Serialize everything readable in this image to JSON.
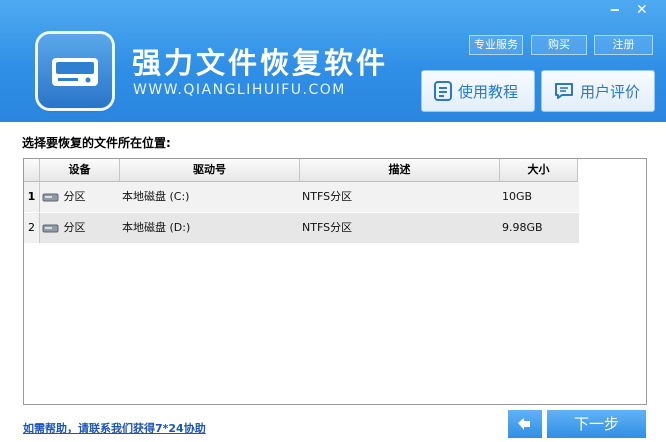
{
  "window": {
    "minimize": "‒",
    "close": "✕"
  },
  "header": {
    "title": "强力文件恢复软件",
    "subtitle": "WWW.QIANGLIHUIFU.COM",
    "links": [
      "专业服务",
      "购买",
      "注册"
    ],
    "tutorial_label": "使用教程",
    "review_label": "用户评价"
  },
  "main": {
    "prompt": "选择要恢复的文件所在位置:",
    "columns": [
      "设备",
      "驱动号",
      "描述",
      "大小"
    ],
    "rows": [
      {
        "num": "1",
        "device": "分区",
        "drive": "本地磁盘 (C:)",
        "desc": "NTFS分区",
        "size": "10GB"
      },
      {
        "num": "2",
        "device": "分区",
        "drive": "本地磁盘 (D:)",
        "desc": "NTFS分区",
        "size": "9.98GB"
      }
    ]
  },
  "footer": {
    "help_link": "如需帮助，请联系我们获得7*24协助",
    "next_label": "下一步"
  },
  "icons": {
    "logo": "hard-drive-icon",
    "tutorial": "document-icon",
    "review": "comment-icon",
    "partition": "disk-icon",
    "back": "back-arrow-icon"
  },
  "colors": {
    "header": "#2f8fe6",
    "accent": "#2b78c8",
    "link": "#1d56b8"
  }
}
